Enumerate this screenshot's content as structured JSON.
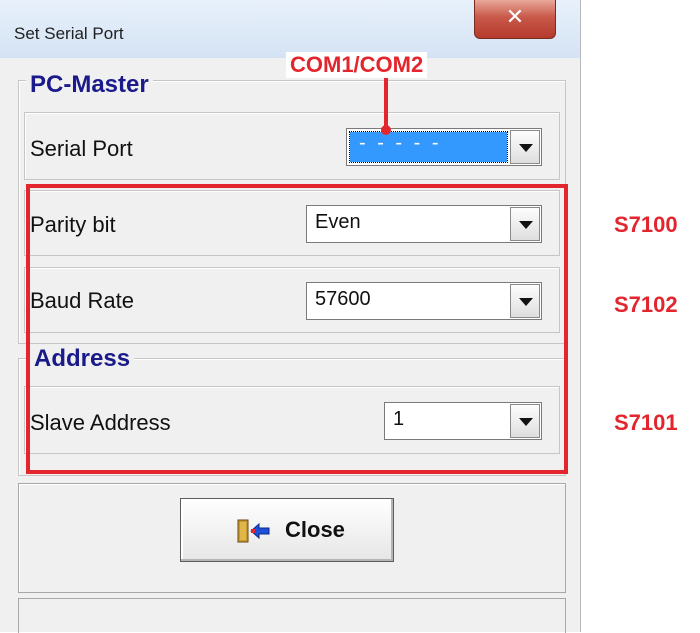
{
  "window": {
    "title": "Set Serial Port",
    "close_glyph": "✕"
  },
  "pc_master": {
    "legend": "PC-Master",
    "serial_port": {
      "label": "Serial Port",
      "value": "- - - - -"
    },
    "parity": {
      "label": "Parity bit",
      "value": "Even"
    },
    "baud": {
      "label": "Baud Rate",
      "value": "57600"
    }
  },
  "address": {
    "legend": "Address",
    "slave": {
      "label": "Slave Address",
      "value": "1"
    }
  },
  "close_button": {
    "label": "Close",
    "icon": "exit-door-icon"
  },
  "annotations": {
    "callout": "COM1/COM2",
    "parity_reg": "S7100",
    "baud_reg": "S7102",
    "slave_reg": "S7101",
    "color": "#e3262d"
  },
  "colors": {
    "legend": "#1a1a8a",
    "selection": "#3399ff"
  }
}
